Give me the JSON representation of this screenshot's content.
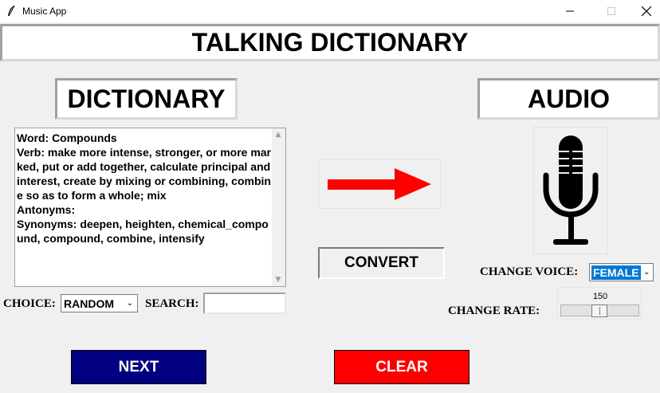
{
  "window": {
    "title": "Music App",
    "icon": "feather-icon"
  },
  "header": {
    "title": "TALKING DICTIONARY"
  },
  "dictionary": {
    "label": "DICTIONARY",
    "text": "Word: Compounds\nVerb: make more intense, stronger, or more marked, put or add together, calculate principal and interest, create by mixing or combining, combine so as to form a whole; mix\nAntonyms:\nSynonyms: deepen, heighten, chemical_compound, compound, combine, intensify"
  },
  "audio": {
    "label": "AUDIO",
    "icon": "microphone-icon"
  },
  "convert": {
    "arrow_icon": "right-arrow-icon",
    "arrow_color": "#ff0000",
    "button_label": "CONVERT"
  },
  "controls": {
    "choice_label": "CHOICE:",
    "choice_value": "RANDOM",
    "search_label": "SEARCH:",
    "search_value": "",
    "voice_label": "CHANGE VOICE:",
    "voice_value": "FEMALE",
    "rate_label": "CHANGE RATE:",
    "rate_value": "150"
  },
  "buttons": {
    "next_label": "NEXT",
    "next_color": "#000080",
    "clear_label": "CLEAR",
    "clear_color": "#ff0000"
  }
}
